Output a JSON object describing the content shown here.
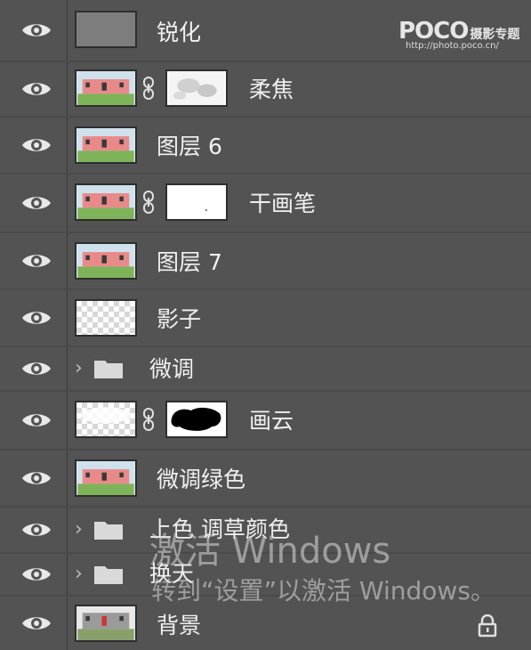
{
  "watermark": {
    "brand": "POCO",
    "brand_cn": "摄影专题",
    "url": "http://photo.poco.cn/"
  },
  "layers": [
    {
      "name": "锐化",
      "thumb": "gray",
      "mask": null,
      "kind": "layer"
    },
    {
      "name": "柔焦",
      "thumb": "photo",
      "mask": "soft",
      "kind": "layer"
    },
    {
      "name": "图层 6",
      "thumb": "photo",
      "mask": null,
      "kind": "layer"
    },
    {
      "name": "干画笔",
      "thumb": "photo",
      "mask": "white",
      "kind": "layer"
    },
    {
      "name": "图层 7",
      "thumb": "photo",
      "mask": null,
      "kind": "layer"
    },
    {
      "name": "影子",
      "thumb": "checker",
      "mask": null,
      "kind": "layer"
    },
    {
      "name": "微调",
      "thumb": null,
      "mask": null,
      "kind": "group"
    },
    {
      "name": "画云",
      "thumb": "checker",
      "mask": "black-cloud",
      "kind": "layer"
    },
    {
      "name": "微调绿色",
      "thumb": "photo",
      "mask": null,
      "kind": "layer"
    },
    {
      "name": "上色 调草颜色",
      "thumb": null,
      "mask": null,
      "kind": "group"
    },
    {
      "name": "换天",
      "thumb": null,
      "mask": null,
      "kind": "group"
    },
    {
      "name": "背景",
      "thumb": "photo-dark",
      "mask": null,
      "kind": "background",
      "locked": true
    }
  ],
  "activation": {
    "title": "激活 Windows",
    "subtitle": "转到“设置”以激活 Windows。"
  },
  "icons": {
    "visibility": "eye-icon",
    "link": "chain-link-icon",
    "group": "folder-icon",
    "expand": "chevron-right-icon",
    "lock": "lock-icon"
  },
  "colors": {
    "panel_bg": "#535353",
    "separator": "#4a4a4a",
    "text": "#f0f0f0"
  }
}
